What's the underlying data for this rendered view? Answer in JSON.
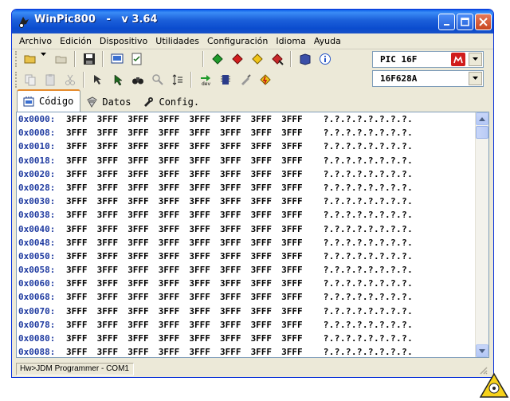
{
  "window": {
    "title": "WinPic800   -   v 3.64"
  },
  "menu": [
    "Archivo",
    "Edición",
    "Dispositivo",
    "Utilidades",
    "Configuración",
    "Idioma",
    "Ayuda"
  ],
  "toolbar": {
    "device_family": "PIC 16F",
    "device_model": "16F628A"
  },
  "tabs": [
    {
      "label": "Código",
      "icon": "code-chip-icon",
      "active": true
    },
    {
      "label": "Datos",
      "icon": "data-chip-icon",
      "active": false
    },
    {
      "label": "Config.",
      "icon": "config-wrench-icon",
      "active": false
    }
  ],
  "memory": {
    "addresses": [
      "0x0000:",
      "0x0008:",
      "0x0010:",
      "0x0018:",
      "0x0020:",
      "0x0028:",
      "0x0030:",
      "0x0038:",
      "0x0040:",
      "0x0048:",
      "0x0050:",
      "0x0058:",
      "0x0060:",
      "0x0068:",
      "0x0070:",
      "0x0078:",
      "0x0080:",
      "0x0088:"
    ],
    "word": "3FFF",
    "ascii": "?.?.?.?.?.?.?.?."
  },
  "status": {
    "programmer": "Hw>JDM Programmer - COM1"
  },
  "colors": {
    "title_blue": "#0a4bce",
    "address_blue": "#1e3aa0",
    "tab_accent": "#e68b2c"
  }
}
